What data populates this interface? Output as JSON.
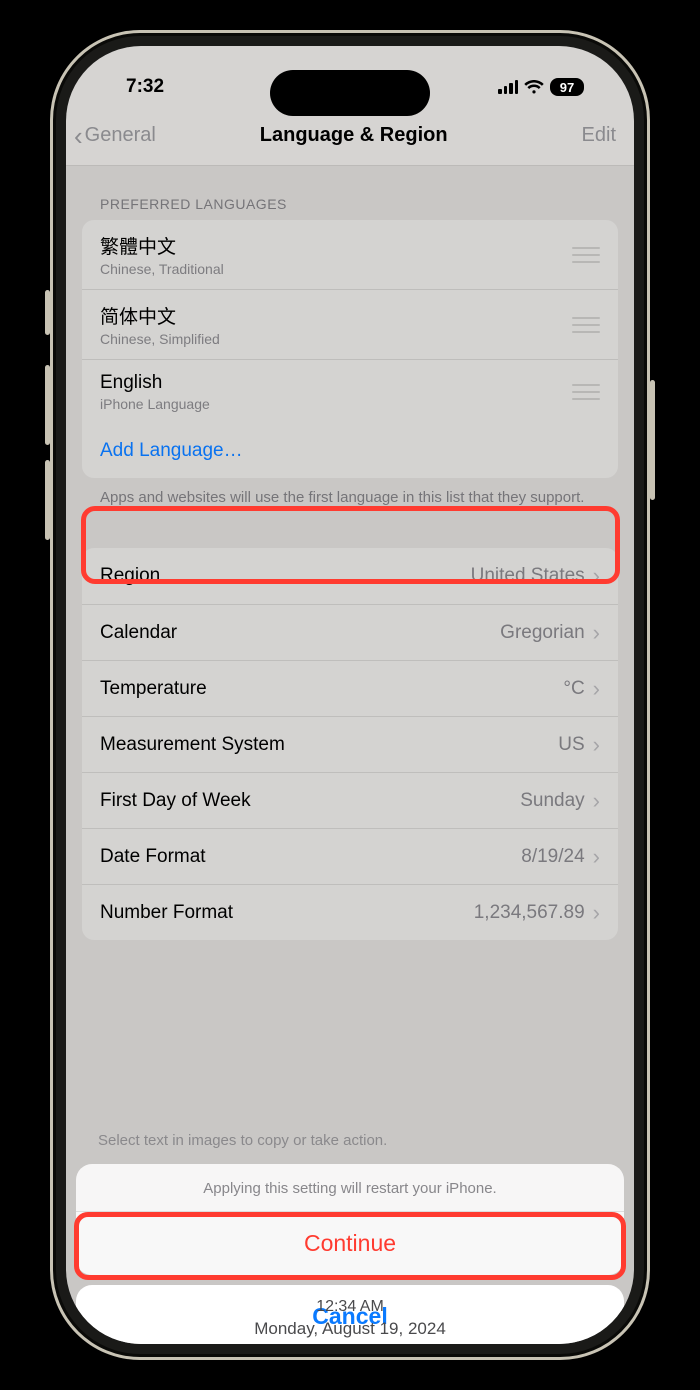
{
  "status": {
    "time": "7:32",
    "battery": "97"
  },
  "nav": {
    "back": "General",
    "title": "Language & Region",
    "edit": "Edit"
  },
  "languages": {
    "header": "PREFERRED LANGUAGES",
    "items": [
      {
        "title": "繁體中文",
        "sub": "Chinese, Traditional"
      },
      {
        "title": "简体中文",
        "sub": "Chinese, Simplified"
      },
      {
        "title": "English",
        "sub": "iPhone Language"
      }
    ],
    "add": "Add Language…",
    "footer": "Apps and websites will use the first language in this list that they support."
  },
  "settings": [
    {
      "label": "Region",
      "value": "United States"
    },
    {
      "label": "Calendar",
      "value": "Gregorian"
    },
    {
      "label": "Temperature",
      "value": "°C"
    },
    {
      "label": "Measurement System",
      "value": "US"
    },
    {
      "label": "First Day of Week",
      "value": "Sunday"
    },
    {
      "label": "Date Format",
      "value": "8/19/24"
    },
    {
      "label": "Number Format",
      "value": "1,234,567.89"
    }
  ],
  "partial": "Select text in images to copy or take action.",
  "sheet": {
    "message": "Applying this setting will restart your iPhone.",
    "continue": "Continue",
    "cancel": "Cancel"
  },
  "preview": {
    "line1": "12:34 AM",
    "line2": "Monday, August 19, 2024"
  }
}
